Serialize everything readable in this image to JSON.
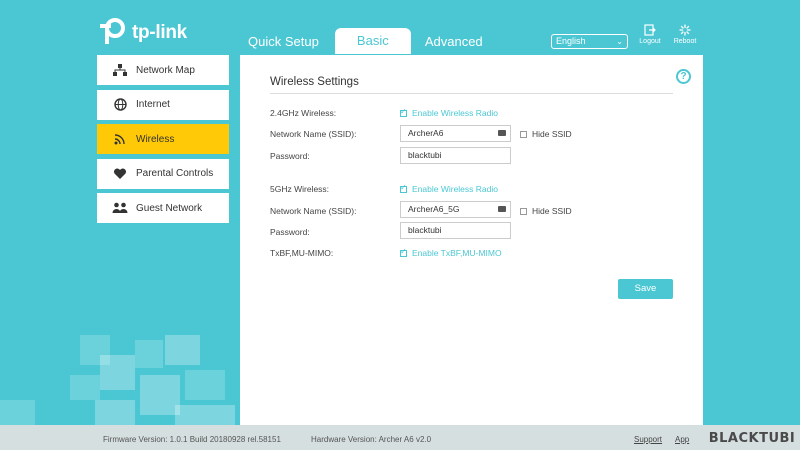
{
  "brand": {
    "logo_text": "tp-link"
  },
  "tabs": [
    {
      "label": "Quick Setup"
    },
    {
      "label": "Basic"
    },
    {
      "label": "Advanced"
    }
  ],
  "header": {
    "language": "English",
    "logout_label": "Logout",
    "reboot_label": "Reboot"
  },
  "sidebar": {
    "items": [
      {
        "label": "Network Map",
        "icon": "network-map-icon"
      },
      {
        "label": "Internet",
        "icon": "globe-icon"
      },
      {
        "label": "Wireless",
        "icon": "wireless-icon"
      },
      {
        "label": "Parental Controls",
        "icon": "heart-icon"
      },
      {
        "label": "Guest Network",
        "icon": "guest-users-icon"
      }
    ]
  },
  "main": {
    "title": "Wireless Settings",
    "band24": {
      "label": "2.4GHz Wireless:",
      "enable_label": "Enable Wireless Radio",
      "ssid_label": "Network Name (SSID):",
      "ssid_value": "ArcherA6",
      "hide_ssid_label": "Hide SSID",
      "password_label": "Password:",
      "password_value": "blacktubi"
    },
    "band5": {
      "label": "5GHz Wireless:",
      "enable_label": "Enable Wireless Radio",
      "ssid_label": "Network Name (SSID):",
      "ssid_value": "ArcherA6_5G",
      "hide_ssid_label": "Hide SSID",
      "password_label": "Password:",
      "password_value": "blacktubi"
    },
    "mimo": {
      "label": "TxBF,MU-MIMO:",
      "enable_label": "Enable TxBF,MU-MIMO"
    },
    "save_label": "Save",
    "help_symbol": "?"
  },
  "footer": {
    "firmware": "Firmware Version: 1.0.1 Build 20180928 rel.58151",
    "hardware": "Hardware Version: Archer A6 v2.0",
    "support_label": "Support",
    "app_label": "App"
  },
  "watermark": "BLACKTUBI",
  "colors": {
    "accent": "#4bc7d3",
    "active_nav": "#ffc907",
    "panel": "#ffffff"
  }
}
